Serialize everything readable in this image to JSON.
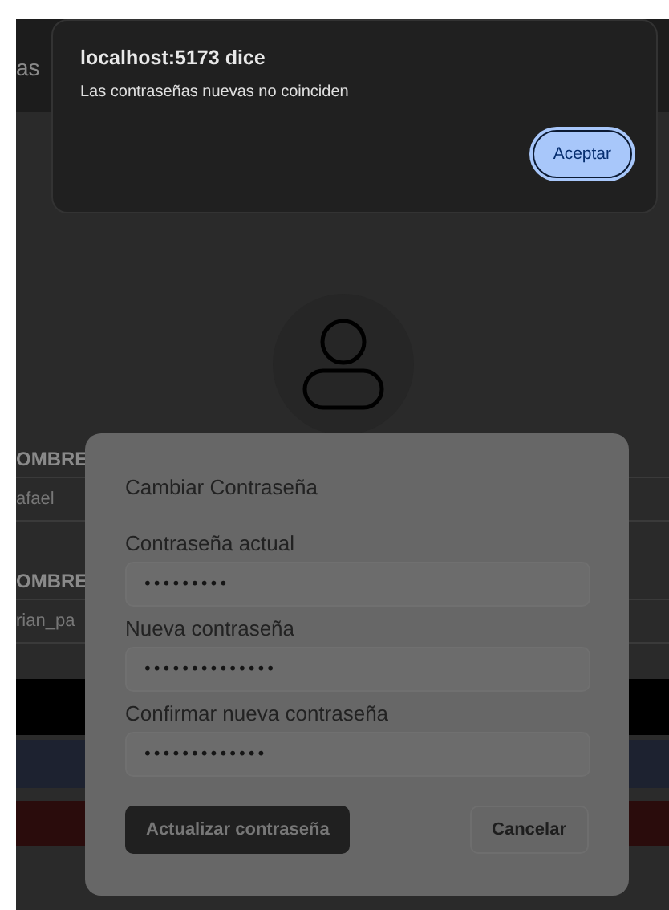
{
  "navbar": {
    "text": "as"
  },
  "background_fields": [
    {
      "label": "OMBRE",
      "value": "afael"
    },
    {
      "label": "OMBRE",
      "value": "rian_pa"
    }
  ],
  "modal": {
    "title": "Cambiar Contraseña",
    "fields": [
      {
        "label": "Contraseña actual",
        "value": "•••••••••"
      },
      {
        "label": "Nueva contraseña",
        "value": "••••••••••••••"
      },
      {
        "label": "Confirmar nueva contraseña",
        "value": "•••••••••••••"
      }
    ],
    "buttons": [
      {
        "label": "Actualizar contraseña",
        "kind": "primary"
      },
      {
        "label": "Cancelar",
        "kind": "secondary"
      }
    ]
  },
  "alert": {
    "title": "localhost:5173 dice",
    "message": "Las contraseñas nuevas no coinciden",
    "button": "Aceptar"
  }
}
